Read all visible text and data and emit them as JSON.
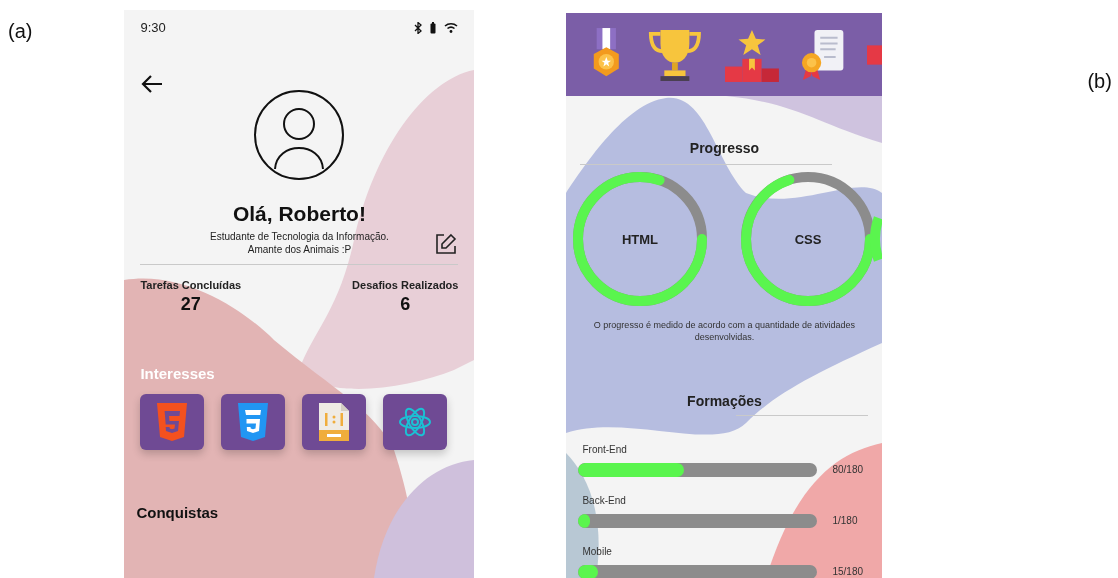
{
  "phone_a": {
    "label": "(a)",
    "status_bar": {
      "time": "9:30"
    },
    "greeting": "Olá, Roberto!",
    "bio": [
      "Estudante de Tecnologia da Informação.",
      "Amante dos Animais :P"
    ],
    "stats": [
      {
        "label": "Tarefas Concluídas",
        "value": "27"
      },
      {
        "label": "Desafios Realizados",
        "value": "6"
      }
    ],
    "interests_title": "Interesses",
    "achievements_title": "Conquistas"
  },
  "phone_b": {
    "label": "(b)",
    "progress": {
      "title": "Progresso",
      "rings": [
        {
          "label": "HTML",
          "level": 0.8
        },
        {
          "label": "CSS",
          "level": 0.7
        }
      ],
      "note": "O progresso é medido de acordo com a quantidade de atividades desenvolvidas."
    },
    "courses": {
      "title": "Formações",
      "items": [
        {
          "name": "Front-End",
          "level": 0.44,
          "reading": "80/180"
        },
        {
          "name": "Back-End",
          "level": 0.04,
          "reading": "1/180"
        },
        {
          "name": "Mobile",
          "level": 0.08,
          "reading": "15/180"
        }
      ]
    }
  }
}
